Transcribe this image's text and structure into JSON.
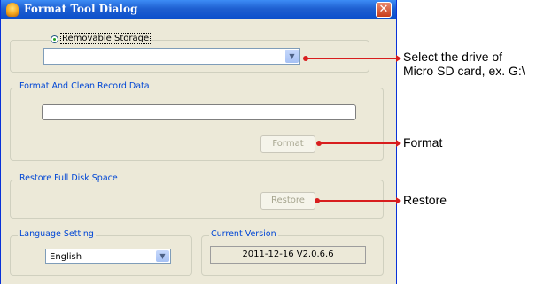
{
  "dialog": {
    "title": "Format Tool Dialog",
    "close_icon": "close-icon",
    "app_icon": "app-icon"
  },
  "storage": {
    "radio_label": "Removable Storage",
    "drive_value": ""
  },
  "format_group": {
    "legend": "Format And Clean Record Data",
    "text_value": "",
    "button_label": "Format"
  },
  "restore_group": {
    "legend": "Restore Full Disk Space",
    "button_label": "Restore"
  },
  "language": {
    "legend": "Language Setting",
    "value": "English"
  },
  "version": {
    "legend": "Current Version",
    "value": "2011-12-16 V2.0.6.6"
  },
  "annotations": {
    "drive_line1": "Select the drive of",
    "drive_line2": "Micro SD card, ex. G:\\",
    "format": "Format",
    "restore": "Restore"
  },
  "colors": {
    "annotation_line": "#d81e1e",
    "titlebar": "#0a4ecb",
    "dialog_bg": "#ece9d8"
  }
}
